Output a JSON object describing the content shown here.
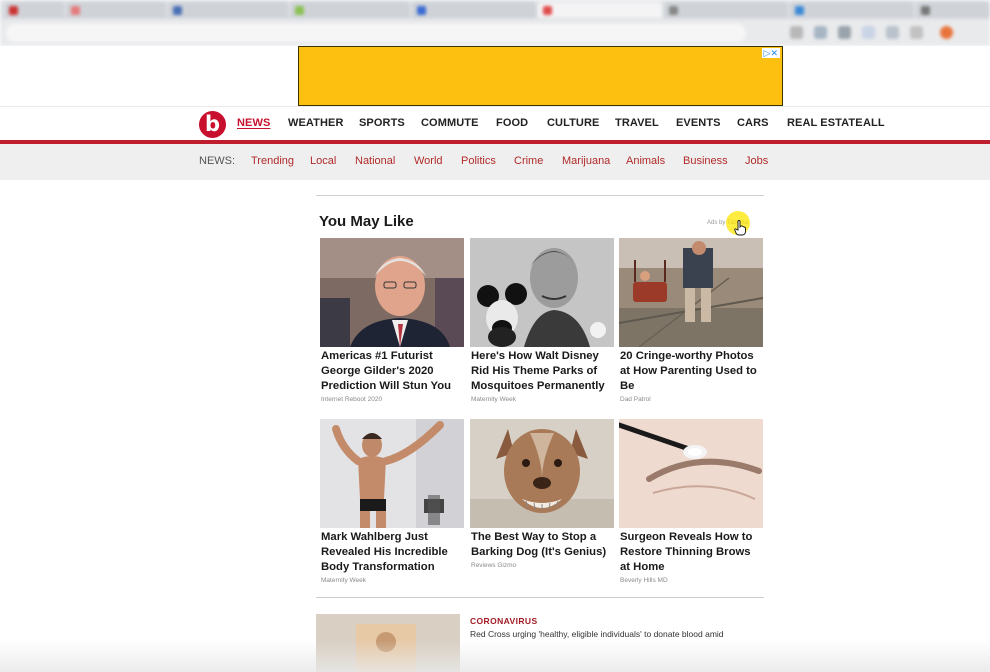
{
  "ad": {
    "choices_label": "▷✕"
  },
  "brand": {
    "logo_letter": "b"
  },
  "main_nav": [
    {
      "label": "NEWS",
      "active": true
    },
    {
      "label": "WEATHER"
    },
    {
      "label": "SPORTS"
    },
    {
      "label": "COMMUTE"
    },
    {
      "label": "FOOD"
    },
    {
      "label": "CULTURE"
    },
    {
      "label": "TRAVEL"
    },
    {
      "label": "EVENTS"
    },
    {
      "label": "CARS"
    },
    {
      "label": "REAL ESTATE"
    },
    {
      "label": "ALL"
    }
  ],
  "sub_nav": {
    "label": "NEWS:",
    "items": [
      "Trending",
      "Local",
      "National",
      "World",
      "Politics",
      "Crime",
      "Marijuana",
      "Animals",
      "Business",
      "Jobs"
    ]
  },
  "recommendations": {
    "heading": "You May Like",
    "ads_by": "Ads by Taboola",
    "cards": [
      {
        "title": "Americas #1 Futurist George Gilder's 2020 Prediction Will Stun You",
        "source": "Internet Reboot 2020"
      },
      {
        "title": "Here's How Walt Disney Rid His Theme Parks of Mosquitoes Permanently",
        "source": "Maternity Week"
      },
      {
        "title": "20 Cringe-worthy Photos at How Parenting Used to Be",
        "source": "Dad Patrol"
      },
      {
        "title": "Mark Wahlberg Just Revealed His Incredible Body Transformation",
        "source": "Maternity Week"
      },
      {
        "title": "The Best Way to Stop a Barking Dog (It's Genius)",
        "source": "Reviews Gizmo"
      },
      {
        "title": "Surgeon Reveals How to Restore Thinning Brows at Home",
        "source": "Beverly Hills MD"
      }
    ]
  },
  "story": {
    "category": "CORONAVIRUS",
    "headline": "Red Cross urging 'healthy, eligible individuals' to donate blood amid"
  },
  "colors": {
    "brand_red": "#c8102e",
    "ad_yellow": "#fdc010",
    "subnav_link": "#b12a2a"
  }
}
